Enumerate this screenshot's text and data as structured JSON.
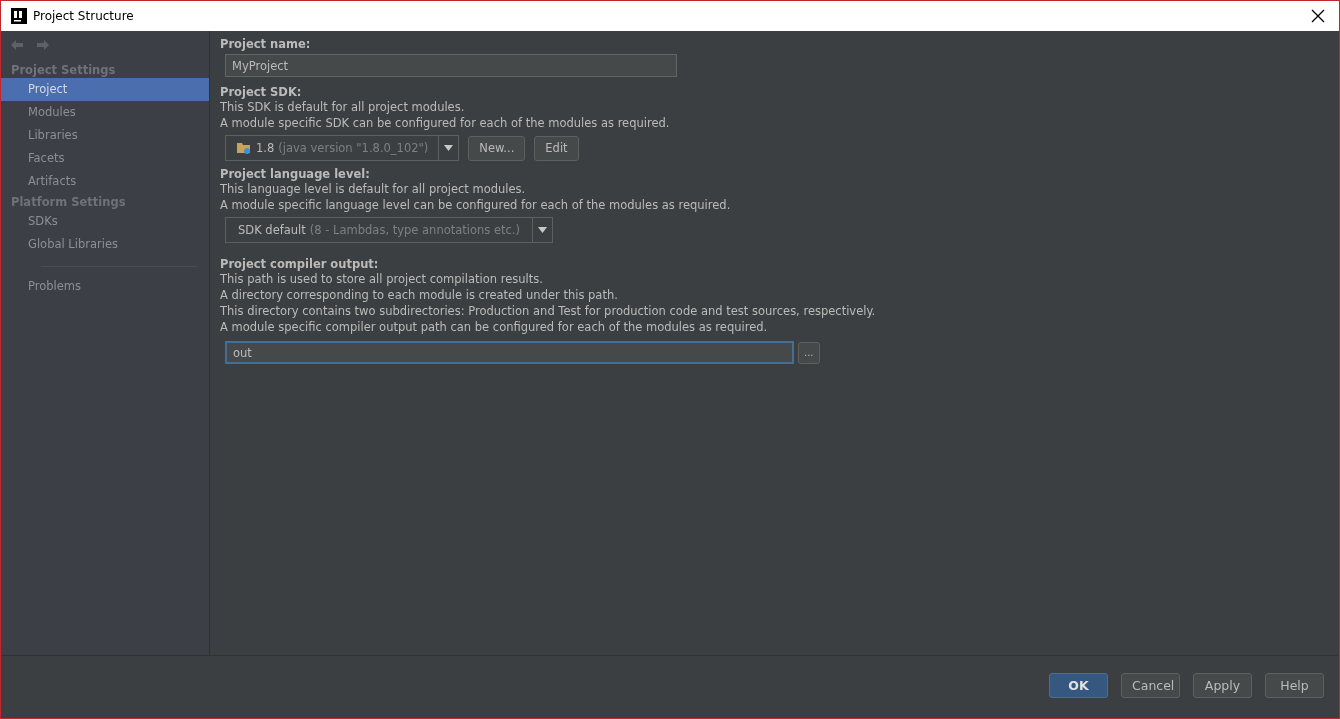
{
  "window": {
    "title": "Project Structure"
  },
  "sidebar": {
    "sections": [
      {
        "title": "Project Settings",
        "items": [
          {
            "label": "Project",
            "selected": true
          },
          {
            "label": "Modules",
            "selected": false
          },
          {
            "label": "Libraries",
            "selected": false
          },
          {
            "label": "Facets",
            "selected": false
          },
          {
            "label": "Artifacts",
            "selected": false
          }
        ]
      },
      {
        "title": "Platform Settings",
        "items": [
          {
            "label": "SDKs",
            "selected": false
          },
          {
            "label": "Global Libraries",
            "selected": false
          }
        ]
      }
    ],
    "extra_items": [
      {
        "label": "Problems",
        "selected": false
      }
    ]
  },
  "project_name": {
    "label": "Project name:",
    "value": "MyProject"
  },
  "project_sdk": {
    "label": "Project SDK:",
    "descriptions": [
      "This SDK is default for all project modules.",
      "A module specific SDK can be configured for each of the modules as required."
    ],
    "combo": {
      "value": "1.8",
      "detail": "(java version \"1.8.0_102\")"
    },
    "buttons": [
      "New...",
      "Edit"
    ]
  },
  "language_level": {
    "label": "Project language level:",
    "descriptions": [
      "This language level is default for all project modules.",
      "A module specific language level can be configured for each of the modules as required."
    ],
    "combo": {
      "value": "SDK default",
      "detail": "(8 - Lambdas, type annotations etc.)"
    }
  },
  "compiler_output": {
    "label": "Project compiler output:",
    "descriptions": [
      "This path is used to store all project compilation results.",
      "A directory corresponding to each module is created under this path.",
      "This directory contains two subdirectories: Production and Test for production code and test sources, respectively.",
      "A module specific compiler output path can be configured for each of the modules as required."
    ],
    "value": "out",
    "focused": true,
    "browse_button": "..."
  },
  "buttons": [
    {
      "label": "OK",
      "kind": "default"
    },
    {
      "label": "Cancel",
      "kind": "normal"
    },
    {
      "label": "Apply",
      "kind": "normal"
    },
    {
      "label": "Help",
      "kind": "normal"
    }
  ]
}
